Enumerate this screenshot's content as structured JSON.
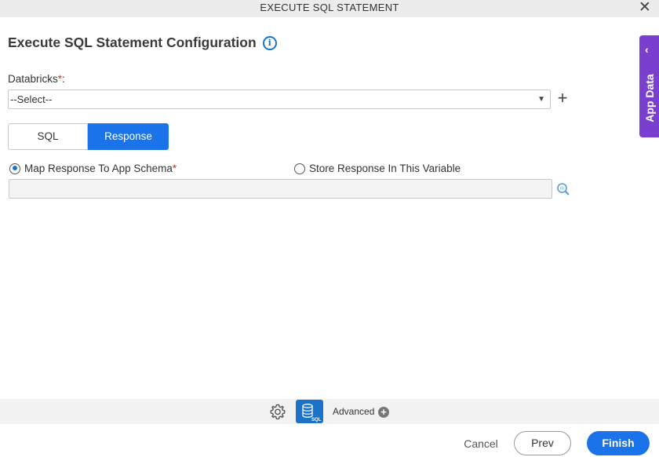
{
  "window": {
    "title": "EXECUTE SQL STATEMENT",
    "close_glyph": "✕"
  },
  "header": {
    "title": "Execute SQL Statement Configuration",
    "info_glyph": "i"
  },
  "databricks": {
    "label": "Databricks",
    "required_mark": "*",
    "label_suffix": ":",
    "selected": "--Select--",
    "arrow_glyph": "▼",
    "add_glyph": "+"
  },
  "tabs": [
    {
      "label": "SQL",
      "active": false
    },
    {
      "label": "Response",
      "active": true
    }
  ],
  "response": {
    "option_map": {
      "label": "Map Response To App Schema",
      "required_mark": "*",
      "selected": true
    },
    "option_store": {
      "label": "Store Response In This Variable",
      "selected": false
    },
    "schema_value": ""
  },
  "app_data_panel": {
    "label": "App Data",
    "chevron_glyph": "‹"
  },
  "toolbar": {
    "advanced_label": "Advanced",
    "advanced_plus_glyph": "+",
    "sql_icon_text": "SQL"
  },
  "footer": {
    "cancel_label": "Cancel",
    "prev_label": "Prev",
    "finish_label": "Finish"
  },
  "colors": {
    "primary": "#1a73e8",
    "app_data_purple": "#7b3fd0",
    "required": "#c0392b"
  }
}
